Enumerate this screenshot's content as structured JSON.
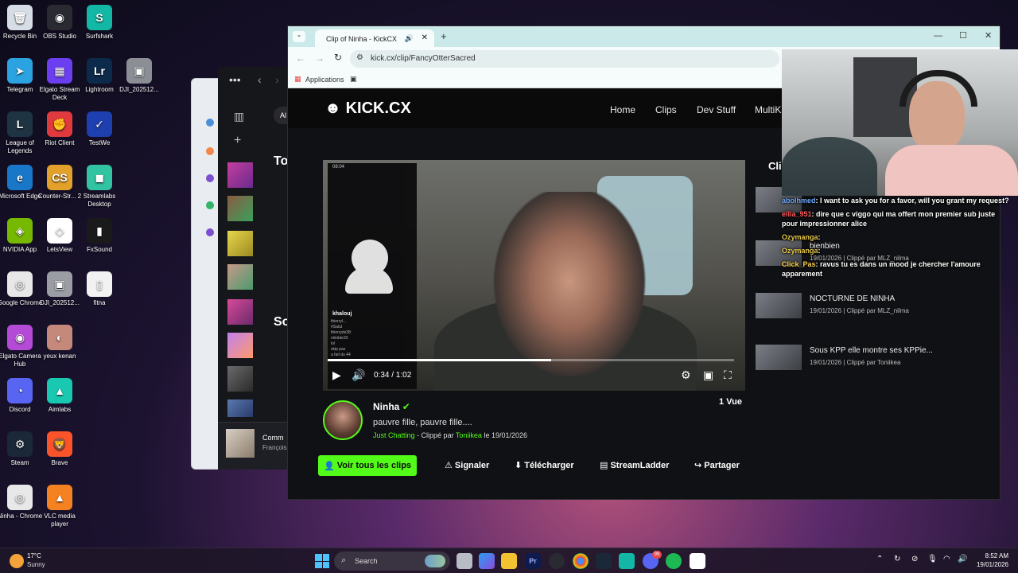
{
  "desktop": {
    "icons": [
      {
        "label": "Recycle Bin",
        "color": "#d7dde6",
        "glyph": "🗑"
      },
      {
        "label": "OBS Studio",
        "color": "#2a2a33",
        "glyph": "◉"
      },
      {
        "label": "Surfshark",
        "color": "#12b7a5",
        "glyph": "S"
      },
      {
        "label": "Telegram",
        "color": "#2aa3e0",
        "glyph": "➤"
      },
      {
        "label": "Elgato Stream Deck",
        "color": "#6b3ff0",
        "glyph": "▦"
      },
      {
        "label": "Lightroom",
        "color": "#0c2b4b",
        "glyph": "Lr"
      },
      {
        "label": "DJI_202512...",
        "color": "#8b8f95",
        "glyph": "▣"
      },
      {
        "label": "League of Legends",
        "color": "#1f3442",
        "glyph": "L"
      },
      {
        "label": "Riot Client",
        "color": "#e03a3e",
        "glyph": "✊"
      },
      {
        "label": "TestWe",
        "color": "#1d3fb0",
        "glyph": "✓"
      },
      {
        "label": "Microsoft Edge",
        "color": "#1877c9",
        "glyph": "e"
      },
      {
        "label": "Counter-Str... 2",
        "color": "#e2a12b",
        "glyph": "CS"
      },
      {
        "label": "Streamlabs Desktop",
        "color": "#31c3a2",
        "glyph": "◼"
      },
      {
        "label": "NVIDIA App",
        "color": "#76b900",
        "glyph": "◈"
      },
      {
        "label": "LetsView",
        "color": "#ffffff",
        "glyph": "◇"
      },
      {
        "label": "FxSound",
        "color": "#1a1a1a",
        "glyph": "▮"
      },
      {
        "label": "Google Chrome",
        "color": "#e8e8e8",
        "glyph": "◎"
      },
      {
        "label": "DJI_202512...",
        "color": "#9a9ea4",
        "glyph": "▣"
      },
      {
        "label": "fitna",
        "color": "#f2f2f2",
        "glyph": "▯"
      },
      {
        "label": "Elgato Camera Hub",
        "color": "#b44ad6",
        "glyph": "◉"
      },
      {
        "label": "yeux kenan",
        "color": "#c4897a",
        "glyph": "◐"
      },
      {
        "label": "Discord",
        "color": "#5865f2",
        "glyph": "◔"
      },
      {
        "label": "Aimlabs",
        "color": "#18c8b0",
        "glyph": "▲"
      },
      {
        "label": "Steam",
        "color": "#1b2838",
        "glyph": "⚙"
      },
      {
        "label": "Brave",
        "color": "#fb542b",
        "glyph": "🦁"
      },
      {
        "label": "Ninha - Chrome",
        "color": "#e8e8e8",
        "glyph": "◎"
      },
      {
        "label": "VLC media player",
        "color": "#f58220",
        "glyph": "▲"
      }
    ]
  },
  "browser": {
    "tab_title": "Clip of Ninha - KickCX",
    "url": "kick.cx/clip/FancyOtterSacred",
    "bookmark_label": "Applications",
    "site": {
      "logo": "KICK.CX",
      "nav": [
        "Home",
        "Clips",
        "Dev Stuff",
        "MultiK"
      ],
      "sidebar_heading": "Cli"
    },
    "player": {
      "time": "0:34 / 1:02",
      "progress": 0.55
    },
    "phone_overlay": {
      "clock": "08:04",
      "username": "khalouj",
      "chat_lines": [
        "thierryl...",
        "#Salut",
        "thierryds38:",
        "niimbie33",
        "lol",
        "skip pas",
        "a fait du 44"
      ]
    },
    "clip": {
      "channel": "Ninha",
      "title": "pauvre fille, pauvre fille....",
      "category": "Just Chatting",
      "clipped_by_prefix": "- Clippé par",
      "clipper": "Toniikea",
      "date_prefix": "le",
      "date": "19/01/2026",
      "views": "1 Vue"
    },
    "actions": {
      "primary": "Voir tous les clips",
      "report": "Signaler",
      "download": "Télécharger",
      "streamladder": "StreamLadder",
      "share": "Partager"
    },
    "related_clips": [
      {
        "title": "bienbien",
        "meta": "19/01/2026 | Clippé par MLZ_nilma"
      },
      {
        "title": "NOCTURNE DE NINHA",
        "meta": "19/01/2026 | Clippé par MLZ_nilma"
      },
      {
        "title": "Sous KPP elle montre ses KPPie...",
        "meta": "19/01/2026 | Clippé par Toniikea"
      }
    ]
  },
  "chat_overlay": [
    {
      "user": "abolhmed",
      "text": ": I want to ask you for a favor, will you grant my request?",
      "color": "#6fa8ff"
    },
    {
      "user": "ellia_951",
      "text": ": dire que c viggo qui ma offert mon premier sub juste pour impressionner alice",
      "color": "#ff5a5a"
    },
    {
      "user": "Ozymanga",
      "text": ": ",
      "color": "#e8c84a"
    },
    {
      "user": "Ozymanga",
      "text": ": ",
      "color": "#e8c84a"
    },
    {
      "user": "Click_Pas",
      "text": ": ravus tu es dans un mood je chercher l'amoure apparement",
      "color": "#ffd24a"
    }
  ],
  "taskbar": {
    "weather_temp": "17°C",
    "weather_desc": "Sunny",
    "search_placeholder": "Search",
    "time": "8:52 AM",
    "date": "19/01/2026",
    "discord_badge": "99"
  },
  "background_app": {
    "heading_1": "To",
    "heading_2": "So",
    "chip": "Al",
    "card_name": "Comm",
    "card_sub": "François"
  }
}
